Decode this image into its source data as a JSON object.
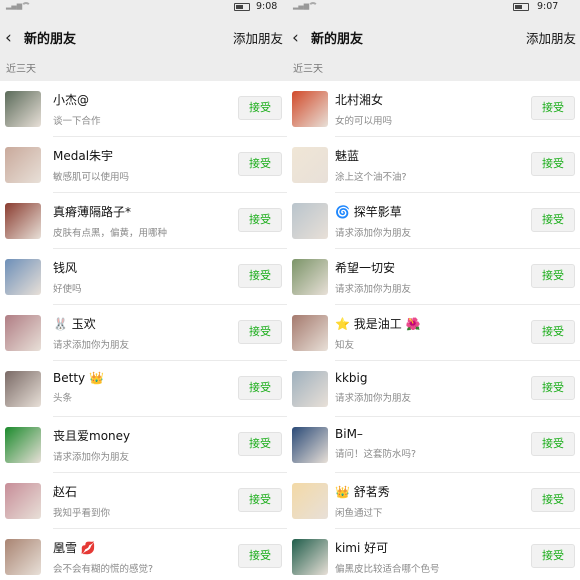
{
  "left": {
    "status": {
      "time": "9:08"
    },
    "title": "新的朋友",
    "add_label": "添加朋友",
    "section": "近三天",
    "accept_label": "接受",
    "items": [
      {
        "name": "小杰@",
        "sub": "谈一下合作",
        "avatar_color": "#5b6b5a"
      },
      {
        "name": "Medal朱宇",
        "sub": "敏感肌可以使用吗",
        "avatar_color": "#c9a99b"
      },
      {
        "name": "真瘠薄隔路子*",
        "sub": "皮肤有点黑，偏黄，用哪种",
        "avatar_color": "#8a3c30"
      },
      {
        "name": "钱风",
        "sub": "好使吗",
        "avatar_color": "#6d8fb8"
      },
      {
        "name": "🐰 玉欢",
        "sub": "请求添加你为朋友",
        "avatar_color": "#b07d84"
      },
      {
        "name": "Betty 👑",
        "sub": "头条",
        "avatar_color": "#7a6a66"
      },
      {
        "name": "丧且爱money",
        "sub": "请求添加你为朋友",
        "avatar_color": "#1b8a2c"
      },
      {
        "name": "赵石",
        "sub": "我知乎看到你",
        "avatar_color": "#c78d98"
      },
      {
        "name": "凰雪 💋",
        "sub": "会不会有糊的慌的感觉?",
        "avatar_color": "#a98472"
      }
    ]
  },
  "right": {
    "status": {
      "time": "9:07"
    },
    "title": "新的朋友",
    "add_label": "添加朋友",
    "section": "近三天",
    "accept_label": "接受",
    "items": [
      {
        "name": "北村湘女",
        "sub": "女的可以用吗",
        "avatar_color": "#d14a2a"
      },
      {
        "name": "魅蓝",
        "sub": "涂上这个油不油?",
        "avatar_color": "#f0e6d6"
      },
      {
        "name": "🌀 探竿影草",
        "sub": "请求添加你为朋友",
        "avatar_color": "#b9c4cc"
      },
      {
        "name": "希望一切安",
        "sub": "请求添加你为朋友",
        "avatar_color": "#7b9468"
      },
      {
        "name": "⭐ 我是油工 🌺",
        "sub": "知友",
        "avatar_color": "#a57a6e"
      },
      {
        "name": "kkbig",
        "sub": "请求添加你为朋友",
        "avatar_color": "#9fb0bd"
      },
      {
        "name": "BiM–",
        "sub": "请问！这套防水吗?",
        "avatar_color": "#2a4a77"
      },
      {
        "name": "👑 舒茗秀",
        "sub": "闲鱼通过下",
        "avatar_color": "#f3d9a6"
      },
      {
        "name": "kimi 好可",
        "sub": "偏黑皮比较适合哪个色号",
        "avatar_color": "#1f5d4a"
      }
    ]
  }
}
